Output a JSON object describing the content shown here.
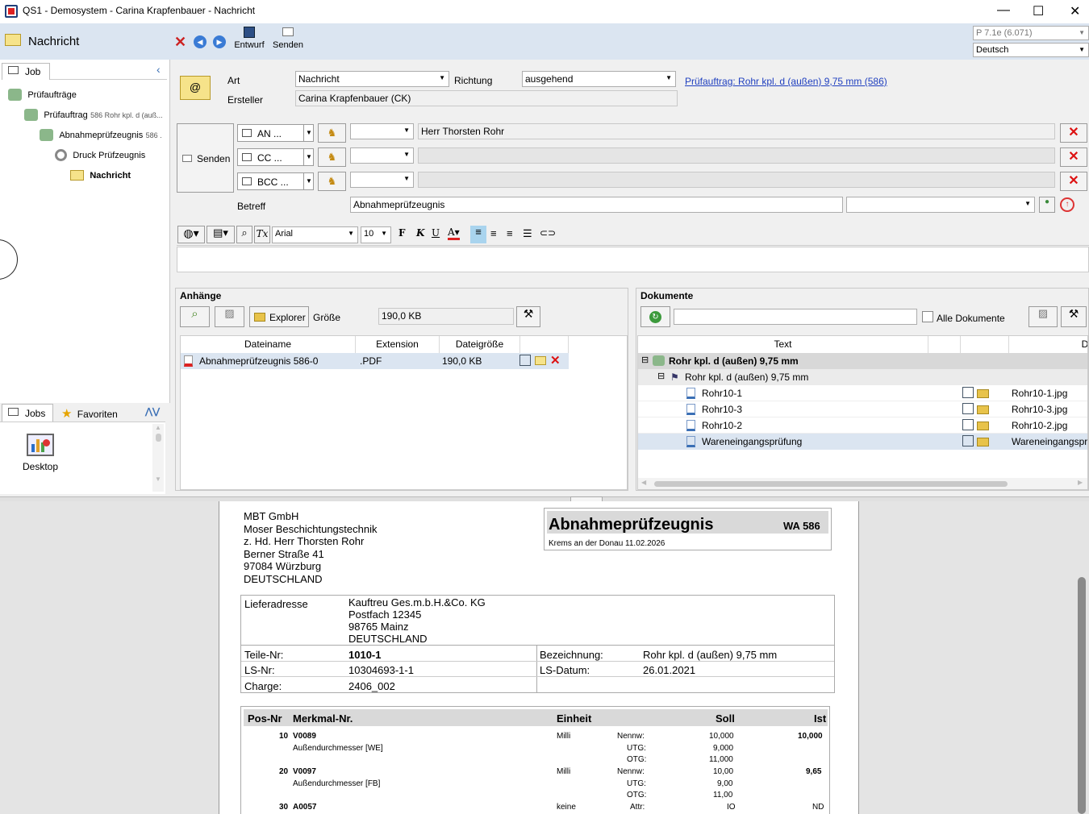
{
  "window": {
    "title": "QS1 - Demosystem - Carina Krapfenbauer - Nachricht"
  },
  "header": {
    "title": "Nachricht",
    "draft_label": "Entwurf",
    "send_label": "Senden",
    "version": "P 7.1e (6.071)",
    "language": "Deutsch"
  },
  "left_panel": {
    "tab": "Job",
    "tree": [
      {
        "label": "Prüfaufträge",
        "extra": ""
      },
      {
        "label": "Prüfauftrag",
        "extra": "586 Rohr kpl. d (auß..."
      },
      {
        "label": "Abnahmeprüfzeugnis",
        "extra": "586 ."
      },
      {
        "label": "Druck Prüfzeugnis",
        "extra": ""
      },
      {
        "label": "Nachricht",
        "extra": ""
      }
    ],
    "bottom_tabs": {
      "jobs": "Jobs",
      "favorites": "Favoriten"
    },
    "desktop_label": "Desktop"
  },
  "message": {
    "art_label": "Art",
    "art_value": "Nachricht",
    "richtung_label": "Richtung",
    "richtung_value": "ausgehend",
    "link": "Prüfauftrag: Rohr kpl. d (außen) 9,75 mm (586)",
    "ersteller_label": "Ersteller",
    "ersteller_value": "Carina Krapfenbauer (CK)",
    "send_label": "Senden",
    "recipients": [
      {
        "type": "AN ...",
        "value": "Herr Thorsten Rohr"
      },
      {
        "type": "CC ...",
        "value": ""
      },
      {
        "type": "BCC ...",
        "value": ""
      }
    ],
    "betreff_label": "Betreff",
    "betreff_value": "Abnahmeprüfzeugnis",
    "font": "Arial",
    "font_size": "10"
  },
  "attachments": {
    "title": "Anhänge",
    "explorer_label": "Explorer",
    "size_label": "Größe",
    "size_value": "190,0 KB",
    "columns": [
      "Dateiname",
      "Extension",
      "Dateigröße"
    ],
    "rows": [
      {
        "name": "Abnahmeprüfzeugnis 586-0",
        "ext": ".PDF",
        "size": "190,0 KB"
      }
    ]
  },
  "documents": {
    "title": "Dokumente",
    "all_label": "Alle Dokumente",
    "col_text": "Text",
    "col_date": "Date",
    "rows": [
      {
        "text": "Rohr kpl. d (außen) 9,75 mm",
        "file": ""
      },
      {
        "text": "Rohr kpl. d (außen) 9,75 mm",
        "file": ""
      },
      {
        "text": "Rohr10-1",
        "file": "Rohr10-1.jpg"
      },
      {
        "text": "Rohr10-3",
        "file": "Rohr10-3.jpg"
      },
      {
        "text": "Rohr10-2",
        "file": "Rohr10-2.jpg"
      },
      {
        "text": "Wareneingangsprüfung",
        "file": "Wareneingangspr"
      }
    ]
  },
  "preview": {
    "address": [
      "MBT GmbH",
      "Moser Beschichtungstechnik",
      "z. Hd. Herr Thorsten Rohr",
      "Berner Straße 41",
      "97084 Würzburg",
      "DEUTSCHLAND"
    ],
    "doc_title": "Abnahmeprüfzeugnis",
    "doc_no": "WA 586",
    "place_date": "Krems an der Donau 11.02.2026",
    "lieferadresse_label": "Lieferadresse",
    "lieferadresse": [
      "Kauftreu Ges.m.b.H.&Co. KG",
      "Postfach 12345",
      "98765 Mainz",
      "DEUTSCHLAND"
    ],
    "teile_label": "Teile-Nr:",
    "teile": "1010-1",
    "bez_label": "Bezeichnung:",
    "bez": "Rohr kpl. d (außen) 9,75 mm",
    "ls_label": "LS-Nr:",
    "ls": "10304693-1-1",
    "lsd_label": "LS-Datum:",
    "lsd": "26.01.2021",
    "charge_label": "Charge:",
    "charge": "2406_002",
    "cols": [
      "Pos-Nr",
      "Merkmal-Nr.",
      "Einheit",
      "Soll",
      "Ist"
    ],
    "items": [
      {
        "pos": "10",
        "nr": "V0089",
        "desc": "Außendurchmesser [WE]",
        "unit": "Milli",
        "l1": "Nennw:",
        "v1": "10,000",
        "l2": "UTG:",
        "v2": "9,000",
        "l3": "OTG:",
        "v3": "11,000",
        "ist": "10,000"
      },
      {
        "pos": "20",
        "nr": "V0097",
        "desc": "Außendurchmesser [FB]",
        "unit": "Milli",
        "l1": "Nennw:",
        "v1": "10,00",
        "l2": "UTG:",
        "v2": "9,00",
        "l3": "OTG:",
        "v3": "11,00",
        "ist": "9,65"
      },
      {
        "pos": "30",
        "nr": "A0057",
        "desc": "",
        "unit": "keine",
        "l1": "Attr:",
        "v1": "IO",
        "l2": "",
        "v2": "",
        "l3": "",
        "v3": "",
        "ist": "ND"
      }
    ]
  }
}
